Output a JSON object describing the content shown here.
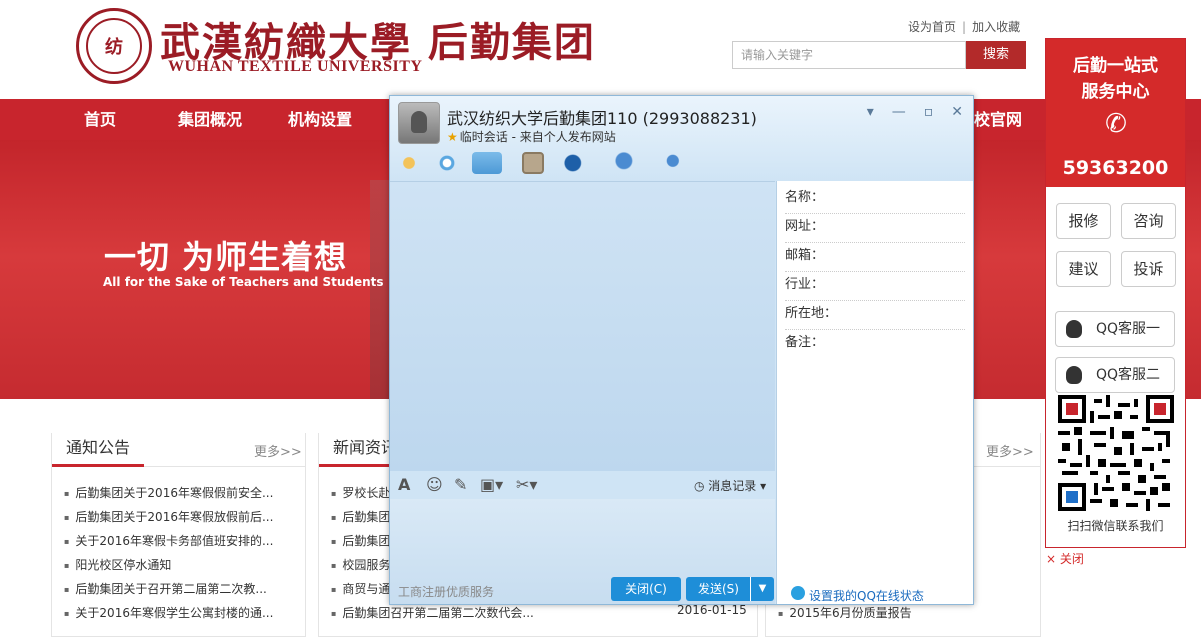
{
  "header": {
    "logo_cn": "武漢紡織大學 后勤集团",
    "logo_en": "WUHAN TEXTILE UNIVERSITY",
    "links": [
      "设为首页",
      "加入收藏"
    ],
    "search_placeholder": "请输入关键字",
    "search_button": "搜索"
  },
  "nav": [
    "首页",
    "团概况",
    "机构设置",
    "校官网"
  ],
  "banner": {
    "slogan_cn": "一切 为师生着想",
    "slogan_en": "All for the Sake of Teachers and Students"
  },
  "panels": {
    "notice": {
      "title": "通知公告",
      "more": "更多>>",
      "items": [
        "后勤集团关于2016年寒假假前安全...",
        "后勤集团关于2016年寒假放假前后...",
        "关于2016年寒假卡务部值班安排的...",
        "阳光校区停水通知",
        "后勤集团关于召开第二届第二次教...",
        "关于2016年寒假学生公寓封楼的通..."
      ]
    },
    "news": {
      "title": "新闻资讯",
      "items": [
        "罗校长赴",
        "后勤集团",
        "后勤集团",
        "校园服务",
        "商贸与通",
        "后勤集团召开第二届第二次数代会..."
      ],
      "last_date": "2016-01-15"
    },
    "third": {
      "more": "更多>>",
      "last_item": "2015年6月份质量报告"
    }
  },
  "widget": {
    "title1": "后勤一站式",
    "title2": "服务中心",
    "phone": "59363200",
    "buttons": [
      "报修",
      "咨询",
      "建议",
      "投诉"
    ],
    "qq1": "QQ客服一",
    "qq2": "QQ客服二",
    "qr_caption": "扫扫微信联系我们",
    "close": "× 关闭"
  },
  "qq_window": {
    "title": "武汉纺织大学后勤集团110 (2993088231)",
    "subtitle": "临时会话 - 来自个人发布网站",
    "message_record": "消息记录",
    "service_text": "工商注册优质服务",
    "close_button": "关闭(C)",
    "send_button": "发送(S)",
    "info_fields": [
      "名称：",
      "网址：",
      "邮箱：",
      "行业：",
      "所在地：",
      "备注："
    ],
    "online_status": "设置我的QQ在线状态"
  }
}
